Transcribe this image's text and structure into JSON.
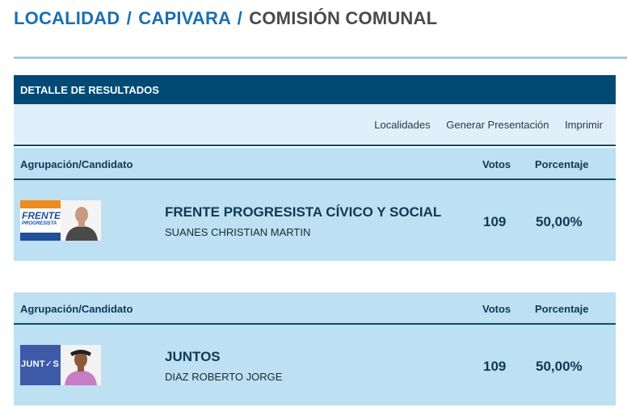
{
  "breadcrumb": {
    "level1": "LOCALIDAD",
    "sep1": "/",
    "level2": "CAPIVARA",
    "sep2": "/",
    "current": "COMISIÓN COMUNAL"
  },
  "panel": {
    "title": "DETALLE DE RESULTADOS",
    "toolbar": [
      "Localidades",
      "Generar Presentación",
      "Imprimir"
    ]
  },
  "table_headers": {
    "col1": "Agrupación/Candidato",
    "col2": "Votos",
    "col3": "Porcentaje"
  },
  "results": [
    {
      "party": "FRENTE PROGRESISTA CÍVICO Y SOCIAL",
      "candidate": "SUANES CHRISTIAN MARTIN",
      "votes": "109",
      "percentage": "50,00%",
      "logo_text": "FRENTE",
      "logo_subtext": "PROGRESISTA",
      "logo_icon": "frente-progresista-logo"
    },
    {
      "party": "JUNTOS",
      "candidate": "DIAZ ROBERTO JORGE",
      "votes": "109",
      "percentage": "50,00%",
      "logo_text": "JUNT✓S",
      "logo_icon": "juntos-logo"
    }
  ],
  "colors": {
    "title_blue": "#1a6fb3",
    "header_dark": "#004a75",
    "row_bg": "#bde0f3",
    "toolbar_bg": "#e0eff9"
  }
}
